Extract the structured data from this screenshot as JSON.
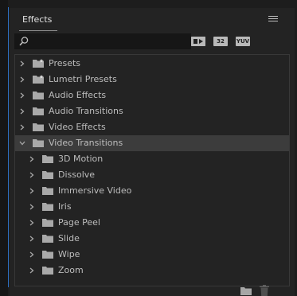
{
  "panel": {
    "title": "Effects",
    "menu_icon": "hamburger-menu-icon"
  },
  "search": {
    "value": "",
    "placeholder": "",
    "icon": "search-icon"
  },
  "filters": {
    "accelerated_label": "",
    "bit32_label": "32",
    "yuv_label": "YUV"
  },
  "tree": [
    {
      "label": "Presets",
      "level": 0,
      "expanded": false,
      "folder": "preset-folder-icon"
    },
    {
      "label": "Lumetri Presets",
      "level": 0,
      "expanded": false,
      "folder": "preset-folder-icon"
    },
    {
      "label": "Audio Effects",
      "level": 0,
      "expanded": false,
      "folder": "folder-icon"
    },
    {
      "label": "Audio Transitions",
      "level": 0,
      "expanded": false,
      "folder": "folder-icon"
    },
    {
      "label": "Video Effects",
      "level": 0,
      "expanded": false,
      "folder": "folder-icon"
    },
    {
      "label": "Video Transitions",
      "level": 0,
      "expanded": true,
      "selected": true,
      "folder": "folder-icon"
    },
    {
      "label": "3D Motion",
      "level": 1,
      "expanded": false,
      "folder": "folder-icon"
    },
    {
      "label": "Dissolve",
      "level": 1,
      "expanded": false,
      "folder": "folder-icon"
    },
    {
      "label": "Immersive Video",
      "level": 1,
      "expanded": false,
      "folder": "folder-icon"
    },
    {
      "label": "Iris",
      "level": 1,
      "expanded": false,
      "folder": "folder-icon"
    },
    {
      "label": "Page Peel",
      "level": 1,
      "expanded": false,
      "folder": "folder-icon"
    },
    {
      "label": "Slide",
      "level": 1,
      "expanded": false,
      "folder": "folder-icon"
    },
    {
      "label": "Wipe",
      "level": 1,
      "expanded": false,
      "folder": "folder-icon"
    },
    {
      "label": "Zoom",
      "level": 1,
      "expanded": false,
      "folder": "folder-icon"
    }
  ],
  "footer": {
    "new_bin_icon": "new-folder-icon",
    "delete_icon": "trash-icon"
  },
  "colors": {
    "panel_bg": "#232323",
    "selected_row": "#3c3c3c",
    "text": "#bdbdbd",
    "focus_border": "#2d6fc2"
  }
}
